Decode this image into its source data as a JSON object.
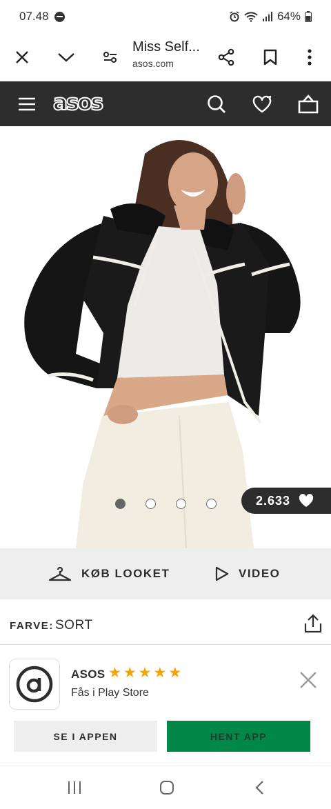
{
  "status_bar": {
    "time": "07.48",
    "battery": "64%"
  },
  "browser": {
    "page_title": "Miss Self...",
    "domain": "asos.com"
  },
  "store": {
    "logo_text": "asos"
  },
  "product": {
    "gallery_total_images": 4,
    "gallery_active_index": 0,
    "saves_count": "2.633"
  },
  "look_bar": {
    "buy_look_label": "KØB LOOKET",
    "video_label": "VIDEO"
  },
  "color": {
    "label": "FARVE:",
    "value": "SORT"
  },
  "app_banner": {
    "app_name": "ASOS",
    "rating_stars": 5,
    "subtitle": "Fås i Play Store",
    "open_in_app_label": "SE I APPEN",
    "get_app_label": "HENT APP"
  },
  "colors": {
    "header_bg": "#2d2d2d",
    "accent_green": "#018849",
    "star_color": "#f5a300"
  },
  "icons": [
    "close-icon",
    "chevron-down-icon",
    "tune-icon",
    "share-icon",
    "bookmark-icon",
    "more-icon",
    "menu-icon",
    "search-icon",
    "heart-icon",
    "bag-icon",
    "hanger-icon",
    "play-icon",
    "share-upload-icon",
    "app-logo-icon",
    "recents-icon",
    "home-icon",
    "back-icon"
  ]
}
